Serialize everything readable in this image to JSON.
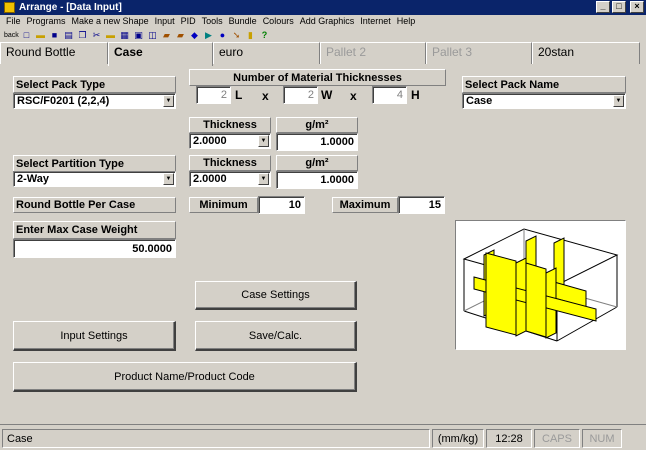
{
  "window": {
    "title": "Arrange - [Data Input]",
    "min": "_",
    "max": "□",
    "close": "×"
  },
  "menu": [
    "File",
    "Programs",
    "Make a new Shape",
    "Input",
    "PID",
    "Tools",
    "Bundle",
    "Colours",
    "Add Graphics",
    "Internet",
    "Help"
  ],
  "toolbar": {
    "back_label": "back",
    "icons": [
      "new-file-icon",
      "open-folder-icon",
      "save-icon",
      "print-icon",
      "copy-icon",
      "cut-icon",
      "folder-icon",
      "calculator-icon",
      "box-icon",
      "box-open-icon",
      "pallet-icon",
      "stack-icon",
      "cube-icon",
      "truck-icon",
      "globe-icon",
      "arrow-icon",
      "bottle-icon",
      "help-icon"
    ]
  },
  "tabs": [
    {
      "label": "Round Bottle",
      "state": "normal"
    },
    {
      "label": "Case",
      "state": "active"
    },
    {
      "label": "euro",
      "state": "normal"
    },
    {
      "label": "Pallet 2",
      "state": "disabled"
    },
    {
      "label": "Pallet 3",
      "state": "disabled"
    },
    {
      "label": "20stan",
      "state": "normal"
    }
  ],
  "form": {
    "pack_type_label": "Select Pack Type",
    "pack_type_value": "RSC/F0201 (2,2,4)",
    "thickness_header": "Number of Material Thicknesses",
    "dims": {
      "l_value": "2",
      "l_label": "L",
      "w_value": "2",
      "w_label": "W",
      "h_value": "4",
      "h_label": "H",
      "x": "x"
    },
    "pack_name_label": "Select Pack Name",
    "pack_name_value": "Case",
    "thickness_label": "Thickness",
    "gsm_label": "g/m²",
    "thickness1_value": "2.0000",
    "gsm1_value": "1.0000",
    "partition_label": "Select Partition Type",
    "partition_value": "2-Way",
    "thickness2_value": "2.0000",
    "gsm2_value": "1.0000",
    "per_case_label": "Round Bottle Per Case",
    "minimum_label": "Minimum",
    "minimum_value": "10",
    "maximum_label": "Maximum",
    "maximum_value": "15",
    "max_weight_label": "Enter Max Case Weight",
    "max_weight_value": "50.0000"
  },
  "buttons": {
    "case_settings": "Case Settings",
    "input_settings": "Input Settings",
    "save_calc": "Save/Calc.",
    "product_name": "Product Name/Product Code"
  },
  "status": {
    "left": "Case",
    "units": "(mm/kg)",
    "time": "12:28",
    "caps": "CAPS",
    "num": "NUM"
  },
  "colors": {
    "titlebar": "#0a246a",
    "face": "#d4d0c8",
    "partition_fill": "#ffff00"
  }
}
